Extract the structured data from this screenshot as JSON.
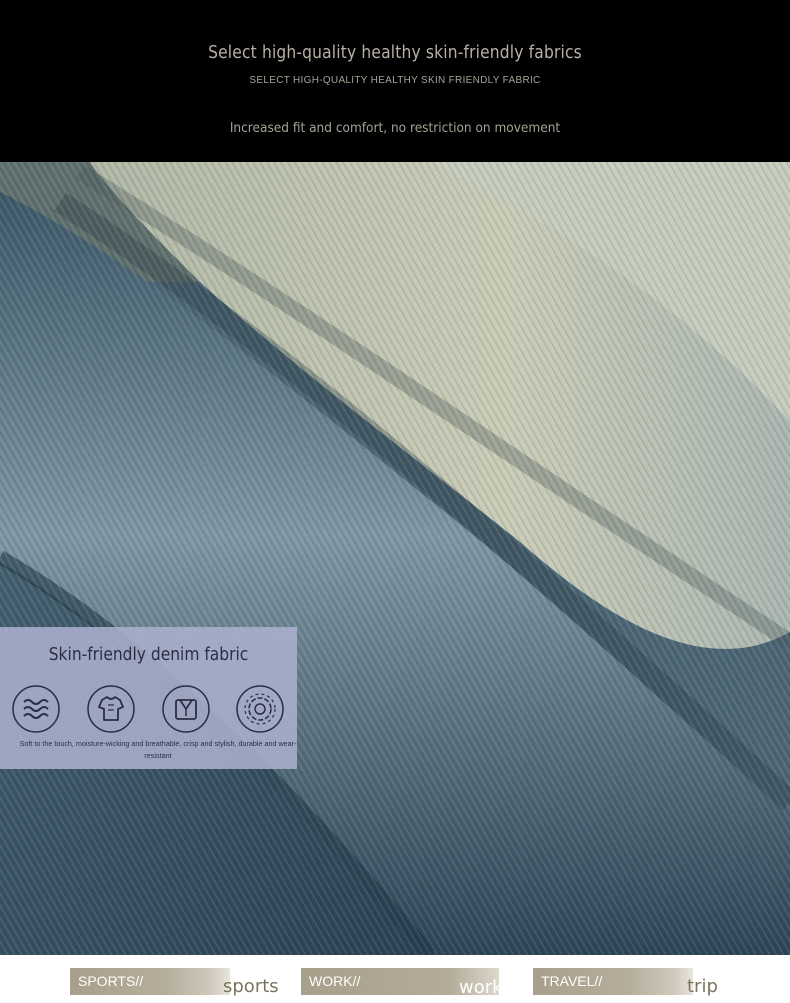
{
  "header": {
    "title": "Select high-quality healthy skin-friendly fabrics",
    "subtitle": "SELECT HIGH-QUALITY HEALTHY SKIN FRIENDLY FABRIC",
    "description": "Increased fit and comfort, no restriction on movement"
  },
  "card": {
    "title": "Skin-friendly denim fabric",
    "description": "Soft to the touch, moisture-wicking and breathable, crisp and stylish, durable and wear-resistant",
    "icons": [
      "waves-icon",
      "shirt-icon",
      "collar-icon",
      "flower-icon"
    ]
  },
  "footer": {
    "tags": [
      {
        "label": "SPORTS//",
        "word": "sports"
      },
      {
        "label": "WORK//",
        "word": "work"
      },
      {
        "label": "TRAVEL//",
        "word": "trip"
      }
    ]
  },
  "colors": {
    "background": "#000000",
    "header_text": "#b9b1a6",
    "denim_blue": "#4f6877",
    "denim_light": "#b9bda9",
    "card_bg": "#aaafcd",
    "tag_bar": "#a89f8b"
  }
}
